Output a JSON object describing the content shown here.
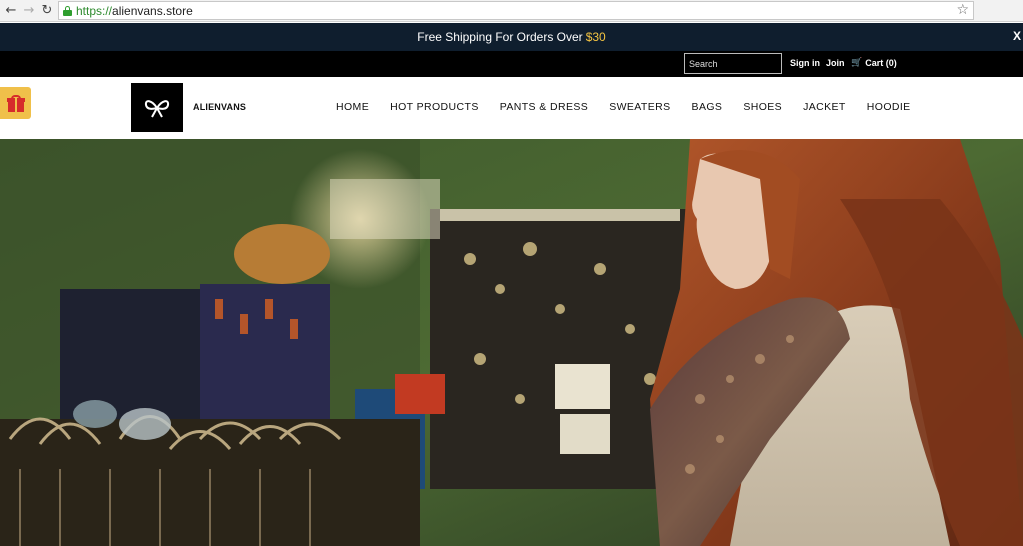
{
  "browser": {
    "url_scheme": "https://",
    "url_host": "alienvans.store",
    "back_icon": "arrow-left-icon",
    "forward_icon": "arrow-right-icon",
    "reload_icon": "reload-icon",
    "bookmark_icon": "star-icon"
  },
  "announcement": {
    "text": "Free Shipping For Orders Over",
    "amount": "$30",
    "close_label": "X",
    "amount_color": "#f5c542",
    "bg_color": "#0f1e2e"
  },
  "utility": {
    "search_placeholder": "Search",
    "signin_label": "Sign in",
    "join_label": "Join",
    "cart_label": "Cart (0)"
  },
  "header": {
    "brand": "ALIENVANS",
    "gift_icon": "gift-icon",
    "logo_icon": "bow-logo-icon"
  },
  "nav": {
    "items": [
      {
        "label": "HOME"
      },
      {
        "label": "HOT PRODUCTS"
      },
      {
        "label": "PANTS & DRESS"
      },
      {
        "label": "SWEATERS"
      },
      {
        "label": "BAGS"
      },
      {
        "label": "SHOES"
      },
      {
        "label": "JACKET"
      },
      {
        "label": "HOODIE"
      }
    ]
  },
  "hero": {
    "image": "woman-shopping-in-clothing-store-photo"
  }
}
